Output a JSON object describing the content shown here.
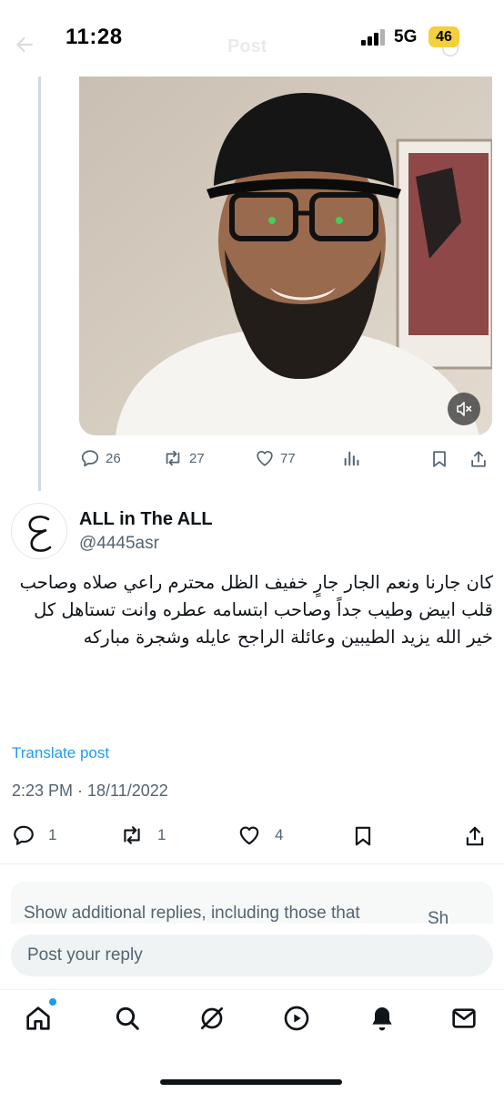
{
  "status_bar": {
    "time": "11:28",
    "network": "5G",
    "battery": "46",
    "faded_title": "Post"
  },
  "quoted_post": {
    "stats": {
      "replies": "26",
      "reposts": "27",
      "likes": "77"
    }
  },
  "post": {
    "display_name": "ALL in The ALL",
    "handle": "@4445asr",
    "avatar_glyph": "ع",
    "text": "كان جارنا ونعم الجار جارٍ خفيف الظل محترم راعي صلاه وصاحب قلب ابيض وطيب جداً وصاحب ابتسامه عطره وانت تستاهل كل خير الله يزيد الطيبين وعائلة الراجح عايله وشجرة مباركه",
    "translate_label": "Translate post",
    "timestamp": "2:23 PM · 18/11/2022",
    "stats": {
      "replies": "1",
      "reposts": "1",
      "likes": "4"
    }
  },
  "additional_replies": {
    "text": "Show additional replies, including those that",
    "trailing": "Sh"
  },
  "composer": {
    "placeholder": "Post your reply"
  },
  "bottom_nav": {
    "items": [
      "home-icon",
      "search-icon",
      "grok-icon",
      "video-icon",
      "notifications-icon",
      "messages-icon"
    ]
  },
  "colors": {
    "accent": "#1d9bf0",
    "secondary_text": "#536471",
    "battery": "#f4d03f"
  }
}
